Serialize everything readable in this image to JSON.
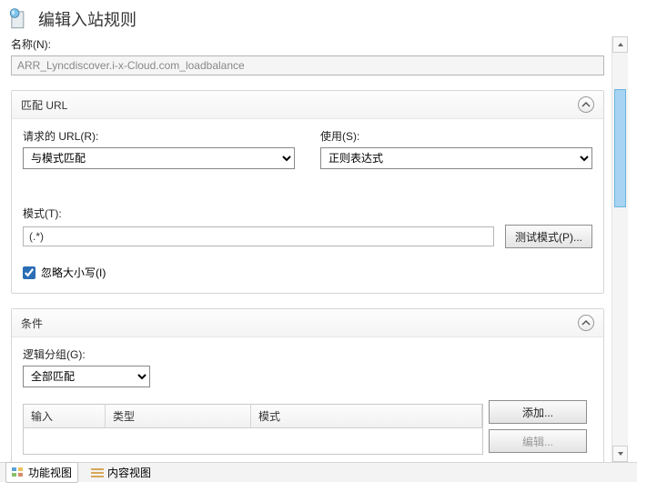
{
  "header": {
    "title": "编辑入站规则"
  },
  "name": {
    "label": "名称(N):",
    "value": "ARR_Lyncdiscover.i-x-Cloud.com_loadbalance"
  },
  "matchUrl": {
    "title": "匹配 URL",
    "requestedUrl": {
      "label": "请求的 URL(R):",
      "value": "与模式匹配"
    },
    "using": {
      "label": "使用(S):",
      "value": "正则表达式"
    },
    "pattern": {
      "label": "模式(T):",
      "value": "(.*)"
    },
    "testPattern": "测试模式(P)...",
    "ignoreCase": "忽略大小写(I)"
  },
  "conditions": {
    "title": "条件",
    "logicalGroup": {
      "label": "逻辑分组(G):",
      "value": "全部匹配"
    },
    "columns": {
      "input": "输入",
      "type": "类型",
      "pattern": "模式"
    },
    "buttons": {
      "add": "添加...",
      "edit": "编辑..."
    }
  },
  "views": {
    "functional": "功能视图",
    "content": "内容视图"
  }
}
